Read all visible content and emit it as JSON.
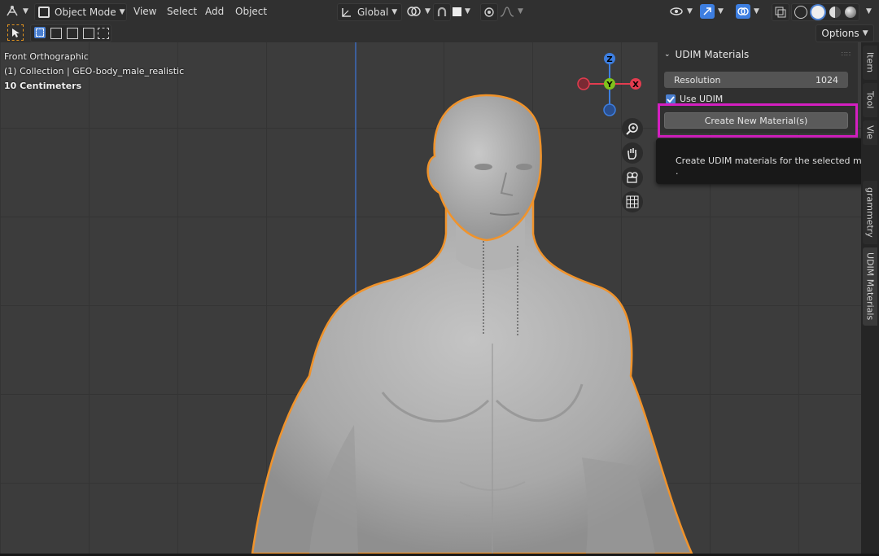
{
  "header": {
    "mode_label": "Object Mode",
    "menus": [
      "View",
      "Select",
      "Add",
      "Object"
    ],
    "transform_orientation": "Global",
    "options_label": "Options"
  },
  "viewport": {
    "view_name": "Front Orthographic",
    "collection_info": "(1) Collection | GEO-body_male_realistic",
    "scale_info": "10 Centimeters",
    "gizmo_axes": {
      "x": "X",
      "y": "Y",
      "z": "Z"
    }
  },
  "udim_panel": {
    "title": "UDIM Materials",
    "resolution_label": "Resolution",
    "resolution_value": "1024",
    "use_udim_label": "Use UDIM",
    "use_udim_checked": true,
    "create_button_label": "Create New Material(s)",
    "tooltip": "Create UDIM materials for the selected mesh.",
    "tooltip_extra": "."
  },
  "side_tabs": [
    "Item",
    "Tool",
    "Vie",
    "grammetry",
    "UDIM Materials"
  ],
  "colors": {
    "selection_outline": "#f0932b",
    "highlight_box": "#d41fc1",
    "axis_x": "#e33c4f",
    "axis_y": "#80c21c",
    "axis_z": "#3d7ee0"
  }
}
